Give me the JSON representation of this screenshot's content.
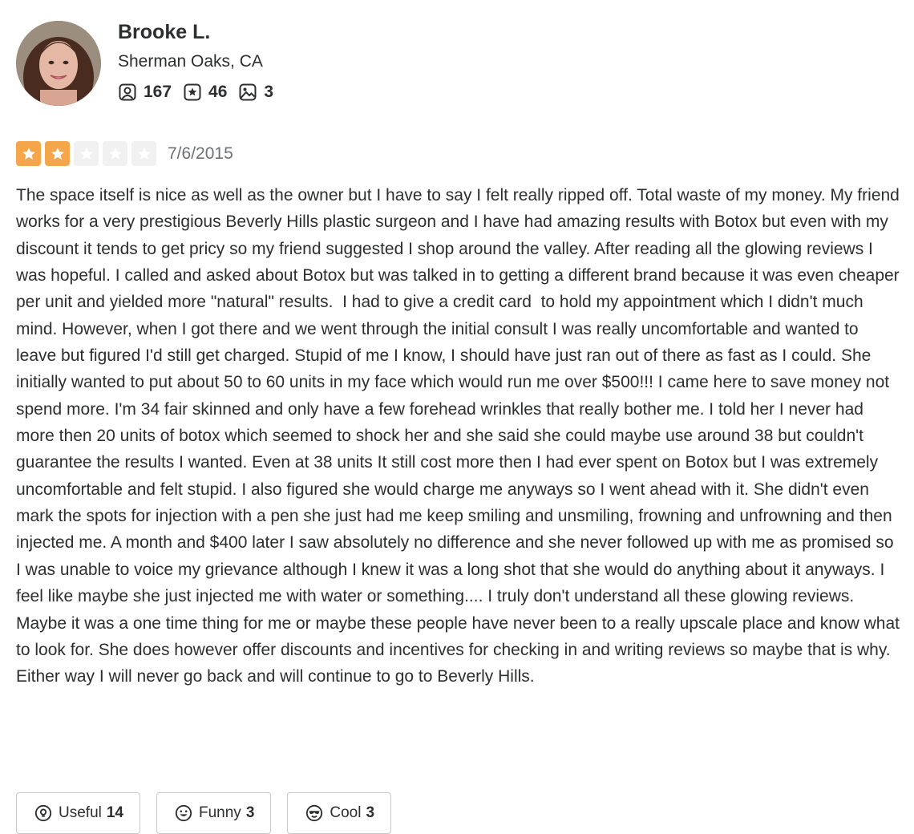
{
  "user": {
    "name": "Brooke L.",
    "location": "Sherman Oaks, CA",
    "friends_count": "167",
    "reviews_count": "46",
    "photos_count": "3"
  },
  "review": {
    "rating": 2,
    "max_rating": 5,
    "date": "7/6/2015",
    "text": "The space itself is nice as well as the owner but I have to say I felt really ripped off. Total waste of my money. My friend works for a very prestigious Beverly Hills plastic surgeon and I have had amazing results with Botox but even with my discount it tends to get pricy so my friend suggested I shop around the valley. After reading all the glowing reviews I was hopeful. I called and asked about Botox but was talked in to getting a different brand because it was even cheaper per unit and yielded more \"natural\" results.  I had to give a credit card  to hold my appointment which I didn't much mind. However, when I got there and we went through the initial consult I was really uncomfortable and wanted to leave but figured I'd still get charged. Stupid of me I know, I should have just ran out of there as fast as I could. She initially wanted to put about 50 to 60 units in my face which would run me over $500!!! I came here to save money not spend more. I'm 34 fair skinned and only have a few forehead wrinkles that really bother me. I told her I never had more then 20 units of botox which seemed to shock her and she said she could maybe use around 38 but couldn't guarantee the results I wanted. Even at 38 units It still cost more then I had ever spent on Botox but I was extremely uncomfortable and felt stupid. I also figured she would charge me anyways so I went ahead with it. She didn't even mark the spots for injection with a pen she just had me keep smiling and unsmiling, frowning and unfrowning and then injected me. A month and $400 later I saw absolutely no difference and she never followed up with me as promised so I was unable to voice my grievance although I knew it was a long shot that she would do anything about it anyways. I feel like maybe she just injected me with water or something.... I truly don't understand all these glowing reviews. Maybe it was a one time thing for me or maybe these people have never been to a really upscale place and know what to look for. She does however offer discounts and incentives for checking in and writing reviews so maybe that is why. Either way I will never go back and will continue to go to Beverly Hills."
  },
  "actions": {
    "useful_label": "Useful",
    "useful_count": "14",
    "funny_label": "Funny",
    "funny_count": "3",
    "cool_label": "Cool",
    "cool_count": "3"
  },
  "colors": {
    "star_filled": "#f5a54a",
    "star_empty": "#f1f1f1",
    "text": "#2d2e2f",
    "muted": "#6e7072"
  },
  "icons": {
    "friends": "friends-icon",
    "reviews": "reviews-star-icon",
    "photos": "photos-icon",
    "useful": "lightbulb-icon",
    "funny": "smile-icon",
    "cool": "sunglasses-icon"
  }
}
